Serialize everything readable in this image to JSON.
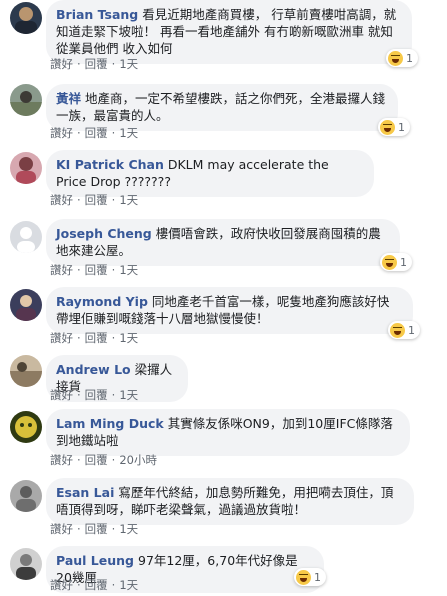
{
  "comments": [
    {
      "author": "Brian Tsang",
      "text": "看見近期地產商買樓， 行草前賣樓咁高調，就知道走緊下坡啦！ 再看一看地產舖外 有冇啲新嘅歐洲車 就知從業員他們 收入如何",
      "like": "讚好",
      "reply": "回覆",
      "time": "1天",
      "reactions": "1"
    },
    {
      "author": "黃祥",
      "text": "地產商，一定不希望樓跌，話之你們死，全港最攞人錢一族，最富貴的人。",
      "like": "讚好",
      "reply": "回覆",
      "time": "1天",
      "reactions": "1"
    },
    {
      "author": "KI Patrick Chan",
      "text": "DKLM may accelerate the Price Drop ???????",
      "like": "讚好",
      "reply": "回覆",
      "time": "1天",
      "reactions": ""
    },
    {
      "author": "Joseph Cheng",
      "text": "樓價唔會跌，政府快收回發展商囤積的農地來建公屋。",
      "like": "讚好",
      "reply": "回覆",
      "time": "1天",
      "reactions": "1"
    },
    {
      "author": "Raymond Yip",
      "text": "同地產老千首富一樣，呢隻地產狗應該好快帶埋佢賺到嘅錢落十八層地獄慢慢使！",
      "like": "讚好",
      "reply": "回覆",
      "time": "1天",
      "reactions": "1"
    },
    {
      "author": "Andrew Lo",
      "text": "梁攞人接貨",
      "like": "讚好",
      "reply": "回覆",
      "time": "1天",
      "reactions": ""
    },
    {
      "author": "Lam Ming Duck",
      "text": "其實條友係咪ON9，加到10厘IFC條隊落到地鐵站啦",
      "like": "讚好",
      "reply": "回覆",
      "time": "20小時",
      "reactions": ""
    },
    {
      "author": "Esan Lai",
      "text": "寫歷年代終結，加息勢所難免，用把嗬去頂住，頂唔頂得到呀，睇吓老梁聲氣，過議過放貨啦！",
      "like": "讚好",
      "reply": "回覆",
      "time": "1天",
      "reactions": ""
    },
    {
      "author": "Paul Leung",
      "text": "97年12厘，6,70年代好像是20幾厘",
      "like": "讚好",
      "reply": "回覆",
      "time": "1天",
      "reactions": "1"
    }
  ],
  "colors": {
    "author": "#385898",
    "bubble": "#f2f3f5",
    "meta": "#606770",
    "haha": "#f7c948"
  }
}
